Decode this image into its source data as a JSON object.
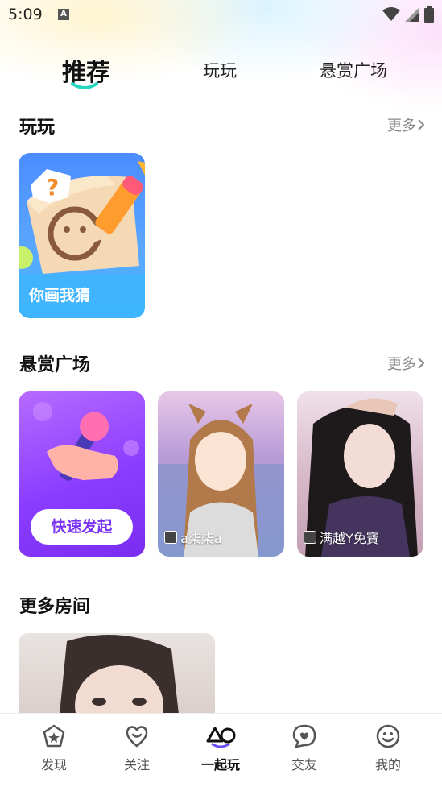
{
  "status_bar": {
    "time": "5:09",
    "notification_icon": "A"
  },
  "tabs": [
    {
      "label": "推荐",
      "active": true
    },
    {
      "label": "玩玩",
      "active": false
    },
    {
      "label": "悬赏广场",
      "active": false
    }
  ],
  "play_section": {
    "title": "玩玩",
    "more": "更多",
    "games": [
      {
        "label": "你画我猜"
      }
    ]
  },
  "bounty_section": {
    "title": "悬赏广场",
    "more": "更多",
    "quick_button": "快速发起",
    "users": [
      {
        "name": "a柒柒a"
      },
      {
        "name": "满越Y免寶"
      }
    ]
  },
  "more_rooms": {
    "title": "更多房间"
  },
  "bottom_nav": [
    {
      "label": "发现",
      "icon": "discover-icon"
    },
    {
      "label": "关注",
      "icon": "heart-icon"
    },
    {
      "label": "一起玩",
      "icon": "play-together-icon",
      "active": true
    },
    {
      "label": "交友",
      "icon": "chat-heart-icon"
    },
    {
      "label": "我的",
      "icon": "smile-face-icon"
    }
  ],
  "colors": {
    "accent": "#25d6c0",
    "bounty_purple": "#8a3dff",
    "game_blue": "#4b8cff"
  }
}
